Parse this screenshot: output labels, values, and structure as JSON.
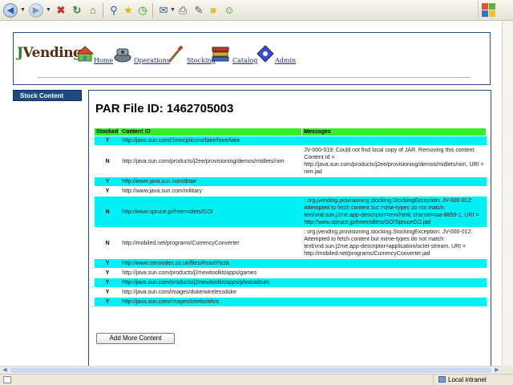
{
  "browser": {
    "toolbar_icons": [
      "back-icon",
      "forward-icon",
      "stop-icon",
      "refresh-icon",
      "home-icon",
      "search-icon",
      "favorites-icon",
      "history-icon",
      "mail-icon",
      "print-icon",
      "edit-icon",
      "discuss-icon",
      "messenger-icon"
    ],
    "status": {
      "zone_label": "Local intranet"
    },
    "colors": {
      "chrome": "#ece9d8"
    }
  },
  "header": {
    "logo": {
      "first": "J",
      "rest": "Vending"
    },
    "nav": [
      {
        "label": "Home",
        "icon": "home-icon"
      },
      {
        "label": "Operations",
        "icon": "operations-icon"
      },
      {
        "label": "Stocking",
        "icon": "stocking-icon"
      },
      {
        "label": "Catalog",
        "icon": "catalog-icon"
      },
      {
        "label": "Admin",
        "icon": "admin-icon"
      }
    ]
  },
  "sidebar": {
    "tab_label": "Stock Content"
  },
  "main": {
    "title": "PAR File ID: 1462705003",
    "columns": [
      "Stocked",
      "Content ID",
      "Messages"
    ],
    "rows": [
      {
        "stocked": "Y",
        "content_id": "http://java.sun.com/j2ee/cp/icons/fake/fake/fake",
        "message": ""
      },
      {
        "stocked": "N",
        "content_id": "http://java.sun.com/products/j2ee/provisioning/demos/midlets/nim",
        "message": "JV-000-019: Could not find local copy of JAR. Removing this content: Content Id = http://java.sun.com/products/j2ee/provisioning/demos/midlets/nim, URI = nim.jad"
      },
      {
        "stocked": "Y",
        "content_id": "http://www.java.sun.com/draw",
        "message": ""
      },
      {
        "stocked": "Y",
        "content_id": "http://www.java.sun.com/military",
        "message": ""
      },
      {
        "stocked": "N",
        "content_id": "http://www.spruce.jp/freemidlets/GO/",
        "message": ": org.jvending.provisioning.stocking.StockingException: JV-000-012: Attempted to fetch content but mime-types do not match: text/vnd.sun.j2me.app-descriptor=text/html; charset=iso-8859-1, URI = http://www.spruce.jp/freemidlets/GO/SpruceGO.jad"
      },
      {
        "stocked": "N",
        "content_id": "http://mobiled.net/programs/CurrencyConverter",
        "message": ": org.jvending.provisioning.stocking.StockingException: JV-000-012: Attempted to fetch content but mime-types do not match: text/vnd.sun.j2me.app-descriptor=application/octet-stream, URI = http://mobiled.net/programs/CurrencyConverter.jad"
      },
      {
        "stocked": "Y",
        "content_id": "http://www.zeroindex.co.uk/files/RoadPizza",
        "message": ""
      },
      {
        "stocked": "Y",
        "content_id": "http://java.sun.com/products/j2mewtoolkit/apps/games",
        "message": ""
      },
      {
        "stocked": "Y",
        "content_id": "http://java.sun.com/products/j2mewtoolkit/apps/photoalbum",
        "message": ""
      },
      {
        "stocked": "Y",
        "content_id": "http://java.sun.com/images/duke/wirelessduke",
        "message": ""
      },
      {
        "stocked": "Y",
        "content_id": "http://java.sun.com/images/celebs/elvis",
        "message": ""
      }
    ],
    "add_button_label": "Add More Content",
    "colors": {
      "header_row": "#33ee22",
      "alt_row": "#00f0f5",
      "border": "#2b4f8c"
    }
  }
}
